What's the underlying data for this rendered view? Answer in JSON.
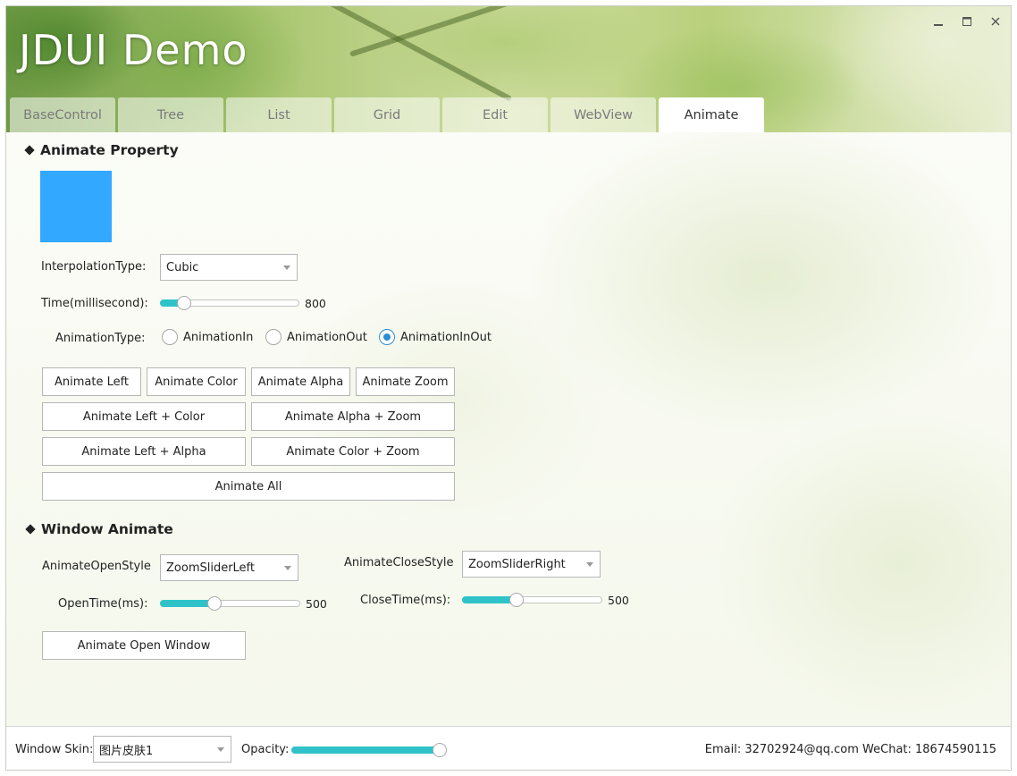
{
  "app": {
    "title": "JDUI Demo"
  },
  "tabs": [
    {
      "label": "BaseControl"
    },
    {
      "label": "Tree"
    },
    {
      "label": "List"
    },
    {
      "label": "Grid"
    },
    {
      "label": "Edit"
    },
    {
      "label": "WebView"
    },
    {
      "label": "Animate"
    }
  ],
  "active_tab": "Animate",
  "animate_property": {
    "title": "Animate Property",
    "box_color": "#33a8ff",
    "interpolation": {
      "label": "InterpolationType:",
      "value": "Cubic"
    },
    "time": {
      "label": "Time(millisecond):",
      "value": "800",
      "fraction": 0.17
    },
    "animation_type": {
      "label": "AnimationType:",
      "options": [
        "AnimationIn",
        "AnimationOut",
        "AnimationInOut"
      ],
      "selected": "AnimationInOut"
    },
    "buttons": {
      "left": "Animate Left",
      "color": "Animate Color",
      "alpha": "Animate Alpha",
      "zoom": "Animate Zoom",
      "left_color": "Animate Left + Color",
      "alpha_zoom": "Animate Alpha + Zoom",
      "left_alpha": "Animate Left + Alpha",
      "color_zoom": "Animate Color + Zoom",
      "all": "Animate All"
    }
  },
  "window_animate": {
    "title": "Window Animate",
    "open_style": {
      "label": "AnimateOpenStyle",
      "value": "ZoomSliderLeft"
    },
    "close_style": {
      "label": "AnimateCloseStyle",
      "value": "ZoomSliderRight"
    },
    "open_time": {
      "label": "OpenTime(ms):",
      "value": "500",
      "fraction": 0.39
    },
    "close_time": {
      "label": "CloseTime(ms):",
      "value": "500",
      "fraction": 0.39
    },
    "open_button": "Animate Open Window"
  },
  "status": {
    "skin_label": "Window Skin:",
    "skin_value": "图片皮肤1",
    "opacity_label": "Opacity:",
    "opacity_fraction": 1.0,
    "contact": "Email: 32702924@qq.com WeChat: 18674590115"
  },
  "colors": {
    "accent": "#2fc3c9",
    "radio": "#2b8fd6"
  }
}
